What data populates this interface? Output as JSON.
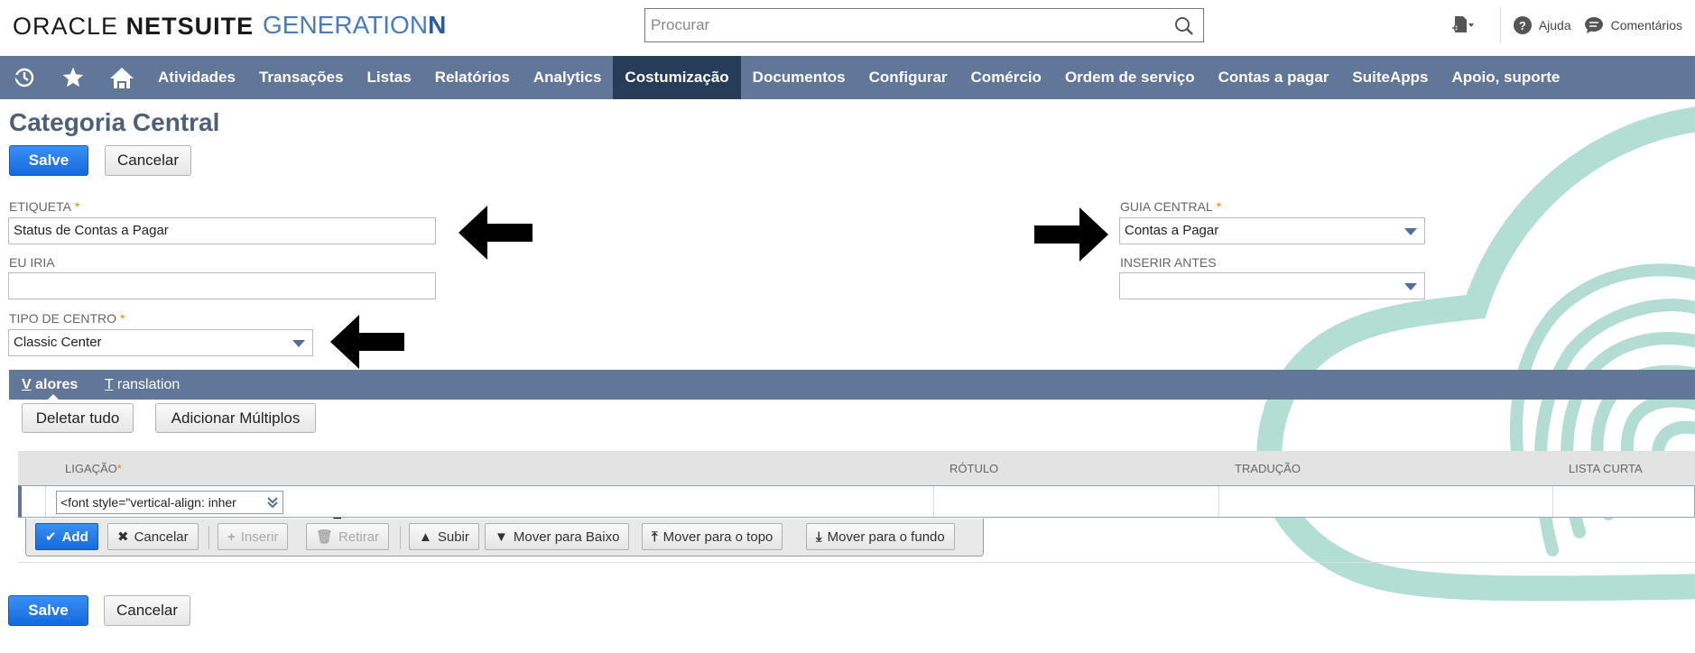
{
  "header": {
    "logo_oracle": "ORACLE",
    "logo_netsuite": "NETSUITE",
    "logo_gen_prefix": "GENERATION",
    "logo_gen_suffix": "N",
    "search_placeholder": "Procurar",
    "help_label": "Ajuda",
    "comments_label": "Comentários"
  },
  "nav": {
    "items": [
      "Atividades",
      "Transações",
      "Listas",
      "Relatórios",
      "Analytics",
      "Costumização",
      "Documentos",
      "Configurar",
      "Comércio",
      "Ordem de serviço",
      "Contas a pagar",
      "SuiteApps",
      "Apoio, suporte"
    ],
    "active": "Costumização"
  },
  "page": {
    "title": "Categoria Central",
    "save_label": "Salve",
    "cancel_label": "Cancelar"
  },
  "form": {
    "etiqueta_label": "ETIQUETA",
    "etiqueta_value": "Status de Contas a Pagar",
    "euiria_label": "EU IRIA",
    "euiria_value": "",
    "tipo_label": "TIPO DE CENTRO",
    "tipo_value": "Classic Center",
    "guia_label": "GUIA CENTRAL",
    "guia_value": "Contas a Pagar",
    "inserir_label": "INSERIR ANTES",
    "inserir_value": ""
  },
  "subtabs": {
    "valores_first": "V",
    "valores_rest": " alores",
    "translation_first": "T",
    "translation_rest": " ranslation"
  },
  "actions": {
    "delete_all": "Deletar tudo",
    "add_multiple": "Adicionar Múltiplos"
  },
  "grid": {
    "columns": [
      "LIGAÇÃO",
      "RÓTULO",
      "TRADUÇÃO",
      "LISTA CURTA"
    ],
    "row_value": "<font style=\"vertical-align: inher",
    "buttons": {
      "add": "Add",
      "cancel": "Cancelar",
      "insert": "Inserir",
      "remove": "Retirar",
      "up": "Subir",
      "down": "Mover para Baixo",
      "top": "Mover para o topo",
      "bottom": "Mover para o fundo"
    }
  },
  "colors": {
    "nav_bg": "#607799",
    "nav_active": "#263d5a",
    "primary": "#1a7ff0",
    "title": "#4d5f79",
    "watermark": "#9fd3c6"
  }
}
